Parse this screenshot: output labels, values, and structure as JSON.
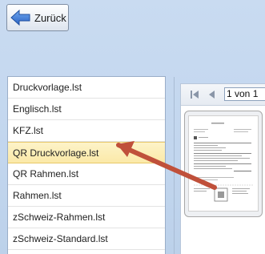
{
  "toolbar": {
    "back_label": "Zurück"
  },
  "list": {
    "items": [
      "Druckvorlage.lst",
      "Englisch.lst",
      "KFZ.lst",
      "QR Druckvorlage.lst",
      "QR Rahmen.lst",
      "Rahmen.lst",
      "zSchweiz-Rahmen.lst",
      "zSchweiz-Standard.lst"
    ],
    "selected_index": 3
  },
  "preview": {
    "page_indicator": "1 von 1"
  },
  "colors": {
    "selection_bg": "#fbe9a8",
    "arrow": "#c0503a",
    "back_arrow": "#2f6fd0"
  }
}
